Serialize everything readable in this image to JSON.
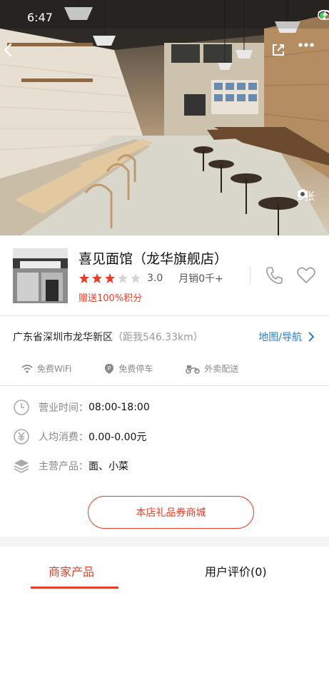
{
  "status_bar": {
    "time": "6:47"
  },
  "hero": {
    "photo_count": "3张"
  },
  "shop": {
    "name": "喜见面馆（龙华旗舰店）",
    "rating_value": "3.0",
    "rating_stars": 3,
    "rating_max": 5,
    "monthly_sales": "月销0千+",
    "bonus": "赠送100%积分"
  },
  "address": {
    "text": "广东省深圳市龙华新区",
    "distance": "（距我546.33km）",
    "map_link": "地图/导航"
  },
  "amenities": [
    {
      "icon": "wifi-icon",
      "label": "免费WiFi"
    },
    {
      "icon": "parking-icon",
      "label": "免费停车"
    },
    {
      "icon": "scooter-icon",
      "label": "外卖配送"
    }
  ],
  "info": {
    "hours_label": "营业时间：",
    "hours_value": "08:00-18:00",
    "avg_label": "人均消费：",
    "avg_value": "0.00-0.00元",
    "main_label": "主营产品：",
    "main_value": "面、小菜"
  },
  "mall_button": "本店礼品券商城",
  "tabs": {
    "products": "商家产品",
    "reviews": "用户评价(0)"
  },
  "colors": {
    "accent": "#e2402b",
    "link": "#2b7cd3",
    "star": "#e2402b"
  }
}
